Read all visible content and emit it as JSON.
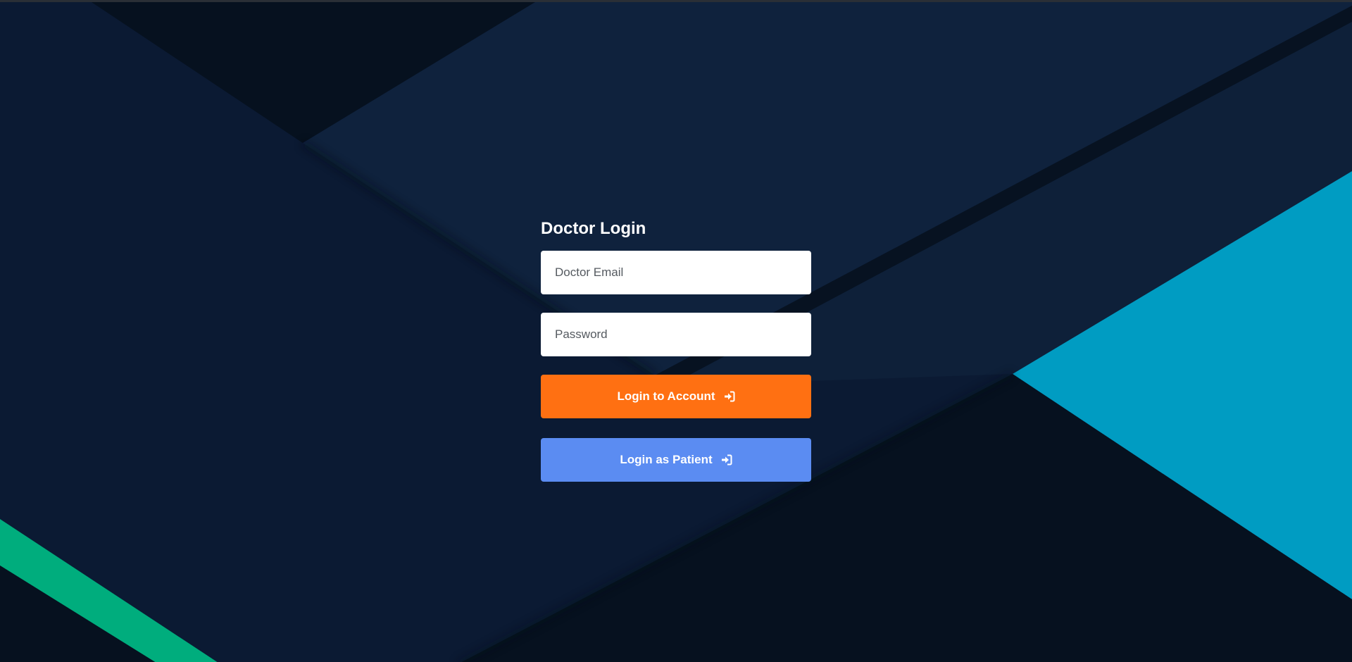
{
  "login": {
    "title": "Doctor Login",
    "email_placeholder": "Doctor Email",
    "password_placeholder": "Password",
    "primary_button_label": "Login to Account",
    "secondary_button_label": "Login as Patient",
    "button_icon": "sign-in-icon"
  },
  "colors": {
    "background": "#0b1a33",
    "primary_button": "#ff7012",
    "secondary_button": "#5b8cf2",
    "accent_cyan": "#009cc2",
    "accent_green": "#00ad7d"
  }
}
